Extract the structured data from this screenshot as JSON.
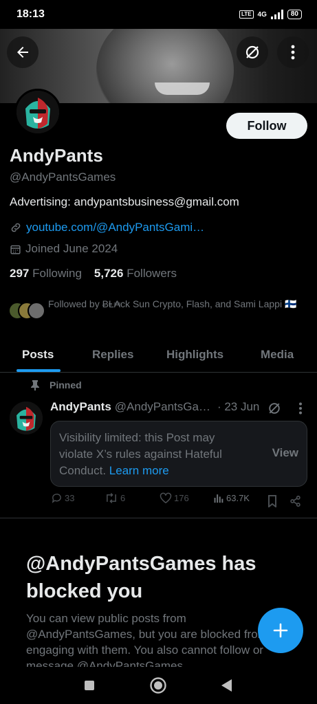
{
  "status_bar": {
    "time": "18:13",
    "network": "4G",
    "volte": "VoLTE",
    "battery": "80"
  },
  "profile": {
    "name": "AndyPants",
    "handle": "@AndyPantsGames",
    "bio": "Advertising: andypantsbusiness@gmail.com",
    "link": "youtube.com/@AndyPantsGami…",
    "joined": "Joined June 2024",
    "following_count": "297",
    "following_label": "Following",
    "followers_count": "5,726",
    "followers_label": "Followers",
    "followed_by": "Followed by ɃⱠ₳ck Sun Crypto, Flash, and Sami Lappi 🇫🇮",
    "follow_label": "Follow"
  },
  "tabs": [
    {
      "label": "Posts"
    },
    {
      "label": "Replies"
    },
    {
      "label": "Highlights"
    },
    {
      "label": "Media"
    }
  ],
  "post": {
    "pinned_label": "Pinned",
    "author": "AndyPants",
    "handle": "@AndyPantsGa…",
    "date": "· 23 Jun",
    "notice": "Visibility limited: this Post may violate X’s rules against Hateful Conduct.",
    "learn_more": "Learn more",
    "view_label": "View",
    "replies": "33",
    "reposts": "6",
    "likes": "176",
    "views": "63.7K"
  },
  "blocked": {
    "title": "@AndyPantsGames has blocked you",
    "body": "You can view public posts from @AndyPantsGames, but you are blocked from engaging with them. You also cannot follow or message @AndyPantsGames."
  },
  "colors": {
    "accent": "#1d9bf0",
    "background": "#000000",
    "muted": "#71767b"
  }
}
